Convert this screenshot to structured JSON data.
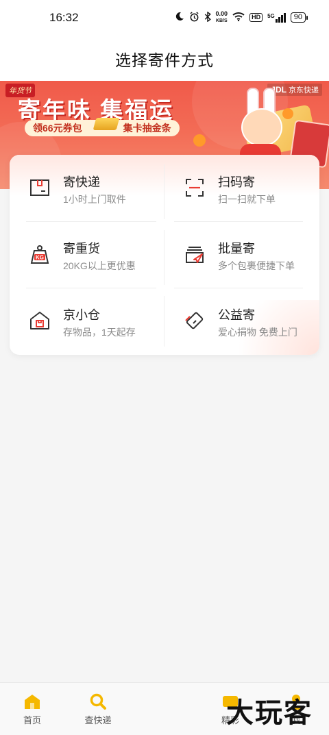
{
  "status_bar": {
    "time": "16:32",
    "net_speed_value": "0.00",
    "net_speed_unit": "KB/S",
    "hd_label": "HD",
    "signal_label": "5G",
    "battery": "90"
  },
  "header": {
    "title": "选择寄件方式"
  },
  "banner": {
    "tag": "年货节",
    "headline": "寄年味 集福运",
    "coupon_text": "领66元券包",
    "card_text": "集卡抽金条",
    "brand_logo": "JDL",
    "brand_name": "京东快递"
  },
  "services": [
    {
      "name": "寄快递",
      "desc": "1小时上门取件",
      "icon": "package-box-icon"
    },
    {
      "name": "扫码寄",
      "desc": "扫一扫就下单",
      "icon": "scan-frame-icon"
    },
    {
      "name": "寄重货",
      "desc": "20KG以上更优惠",
      "icon": "weight-kg-icon"
    },
    {
      "name": "批量寄",
      "desc": "多个包裹便捷下单",
      "icon": "batch-send-icon"
    },
    {
      "name": "京小仓",
      "desc": "存物品，1天起存",
      "icon": "warehouse-icon"
    },
    {
      "name": "公益寄",
      "desc": "爱心捐物 免费上门",
      "icon": "charity-icon"
    }
  ],
  "tabbar": {
    "items": [
      {
        "label": "首页",
        "icon": "home-icon"
      },
      {
        "label": "查快递",
        "icon": "search-icon"
      },
      {
        "label": "精彩",
        "icon": "highlights-icon"
      },
      {
        "label": "我",
        "icon": "profile-icon"
      }
    ]
  },
  "watermark": "大玩客",
  "colors": {
    "accent": "#e93b32",
    "tab_active": "#f5b800"
  }
}
